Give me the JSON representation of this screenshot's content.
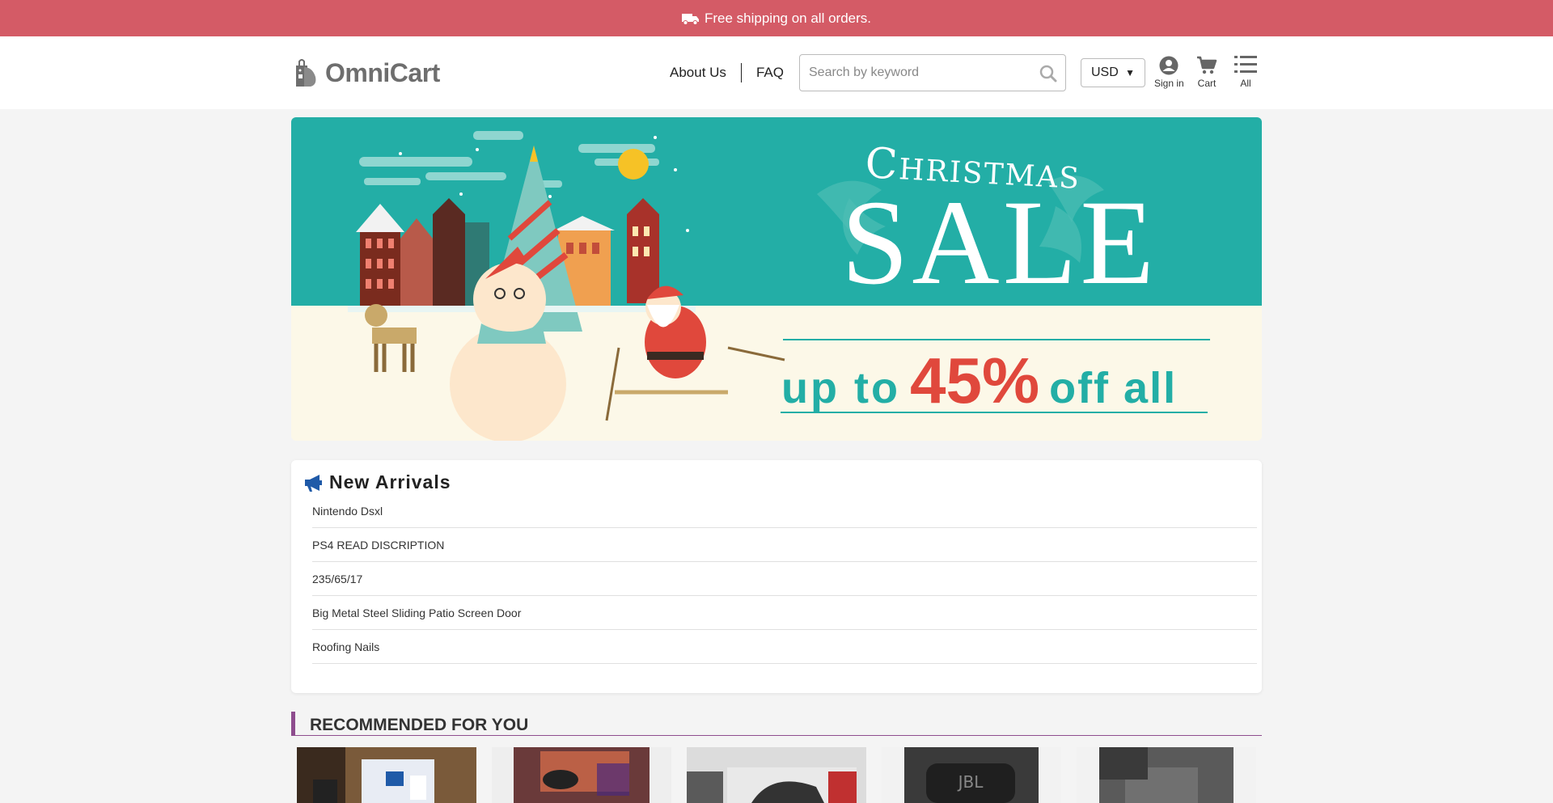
{
  "topbar": {
    "text": "Free shipping on all orders."
  },
  "header": {
    "logo_text": "OmniCart",
    "nav": [
      {
        "label": "About Us"
      },
      {
        "label": "FAQ"
      }
    ],
    "search": {
      "placeholder": "Search by keyword",
      "value": ""
    },
    "currency": "USD",
    "icons": {
      "signin_label": "Sign in",
      "cart_label": "Cart",
      "all_label": "All"
    }
  },
  "banner": {
    "title_top": "Christmas",
    "title_main": "SALE",
    "promo_prefix": "up to",
    "promo_percent": "45%",
    "promo_suffix": "off all"
  },
  "new_arrivals": {
    "title": "New Arrivals",
    "items": [
      "Nintendo Dsxl",
      "PS4 READ DISCRIPTION",
      "235/65/17",
      "Big Metal Steel Sliding Patio Screen Door",
      "Roofing Nails"
    ]
  },
  "recommended": {
    "title": "RECOMMENDED FOR YOU"
  },
  "colors": {
    "topbar": "#d45b66",
    "banner_teal": "#23aea6",
    "banner_red": "#e0483c",
    "accent_purple": "#8e4d8e",
    "icon_blue": "#1f5aa8"
  }
}
